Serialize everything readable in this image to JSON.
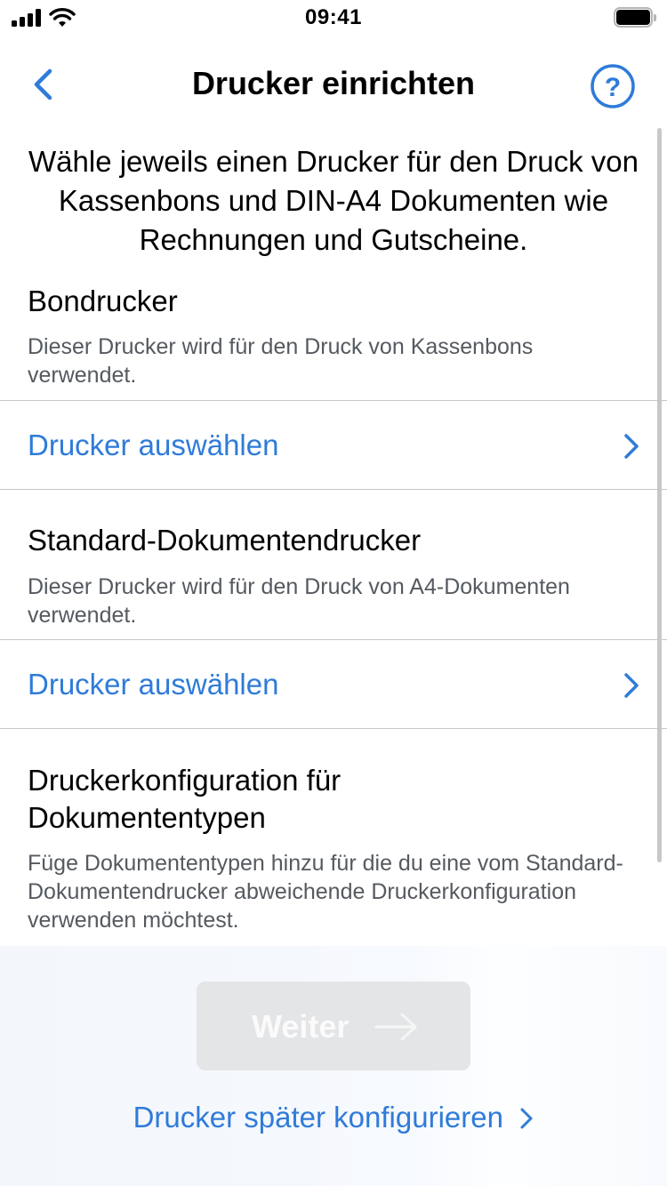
{
  "status_bar": {
    "time": "09:41",
    "icons": [
      "signal-icon",
      "wifi-icon",
      "battery-icon"
    ]
  },
  "nav": {
    "title": "Drucker einrichten",
    "back_icon": "chevron-left-icon",
    "help_icon": "question-circle-icon"
  },
  "intro": "Wähle jeweils einen Drucker für den Druck von Kassenbons und DIN-A4 Dokumenten wie Rechnungen und Gutscheine.",
  "sections": {
    "receipt_printer": {
      "title": "Bondrucker",
      "description": "Dieser Drucker wird für den Druck von Kassenbons verwendet.",
      "action_label": "Drucker auswählen"
    },
    "document_printer": {
      "title": "Standard-Dokumentendrucker",
      "description": "Dieser Drucker wird für den Druck von A4-Dokumenten verwendet.",
      "action_label": "Drucker auswählen"
    },
    "document_types": {
      "title": "Druckerkonfiguration für Dokumententypen",
      "description": "Füge Dokumententypen hinzu für die du eine vom Standard-Dokumentendrucker abweichende Druckerkonfiguration verwenden möchtest."
    }
  },
  "footer": {
    "next_label": "Weiter",
    "next_enabled": false,
    "later_label": "Drucker später konfigurieren"
  },
  "colors": {
    "accent": "#2f7bd9",
    "secondary_text": "#555a60",
    "divider": "#c6c6c8",
    "disabled_button": "#e4e5e7"
  }
}
